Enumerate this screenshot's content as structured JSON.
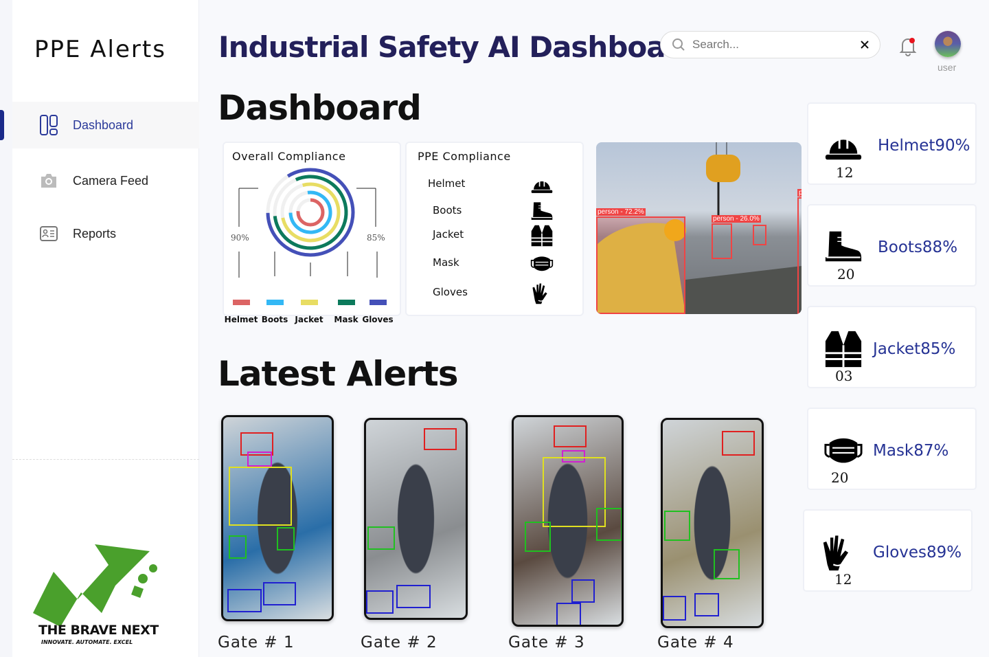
{
  "sidebar": {
    "brand": "PPE Alerts",
    "items": [
      {
        "label": "Dashboard",
        "icon": "dashboard-icon",
        "active": true
      },
      {
        "label": "Camera Feed",
        "icon": "camera-icon"
      },
      {
        "label": "Reports",
        "icon": "id-card-icon"
      }
    ],
    "logo": {
      "name": "THE BRAVE NEXT",
      "tagline": "INNOVATE. AUTOMATE. EXCEL"
    }
  },
  "header": {
    "title": "Industrial Safety AI Dashboard",
    "search_placeholder": "Search...",
    "user_label": "user",
    "notification_dot": true
  },
  "dashboard": {
    "heading": "Dashboard",
    "overall": {
      "title": "Overall Compliance",
      "left_pct": "90%",
      "right_pct": "85%",
      "series": [
        {
          "label": "Helmet",
          "value": 90,
          "color": "#dc6464"
        },
        {
          "label": "Boots",
          "value": 88,
          "color": "#33b8f5"
        },
        {
          "label": "Jacket",
          "value": 85,
          "color": "#e8dd63"
        },
        {
          "label": "Mask",
          "value": 87,
          "color": "#0c7a5c"
        },
        {
          "label": "Gloves",
          "value": 89,
          "color": "#4450b8"
        }
      ]
    },
    "ppe": {
      "title": "PPE Compliance",
      "items": [
        "Helmet",
        "Boots",
        "Jacket",
        "Mask",
        "Gloves"
      ]
    },
    "feed": {
      "detections": [
        "person - 72.2%",
        "person - 26.0%",
        "pe"
      ]
    }
  },
  "stats": [
    {
      "label": "Helmet90%",
      "count": "12",
      "icon": "helmet-icon"
    },
    {
      "label": "Boots88%",
      "count": "20",
      "icon": "boot-icon"
    },
    {
      "label": "Jacket85%",
      "count": "03",
      "icon": "vest-icon"
    },
    {
      "label": "Mask87%",
      "count": "20",
      "icon": "mask-icon"
    },
    {
      "label": "Gloves89%",
      "count": "12",
      "icon": "gloves-icon"
    }
  ],
  "alerts": {
    "heading": "Latest Alerts",
    "items": [
      {
        "gate": "Gate # 1"
      },
      {
        "gate": "Gate # 2"
      },
      {
        "gate": "Gate # 3"
      },
      {
        "gate": "Gate # 4"
      }
    ]
  },
  "colors": {
    "accent": "#253294",
    "title": "#23205a"
  }
}
